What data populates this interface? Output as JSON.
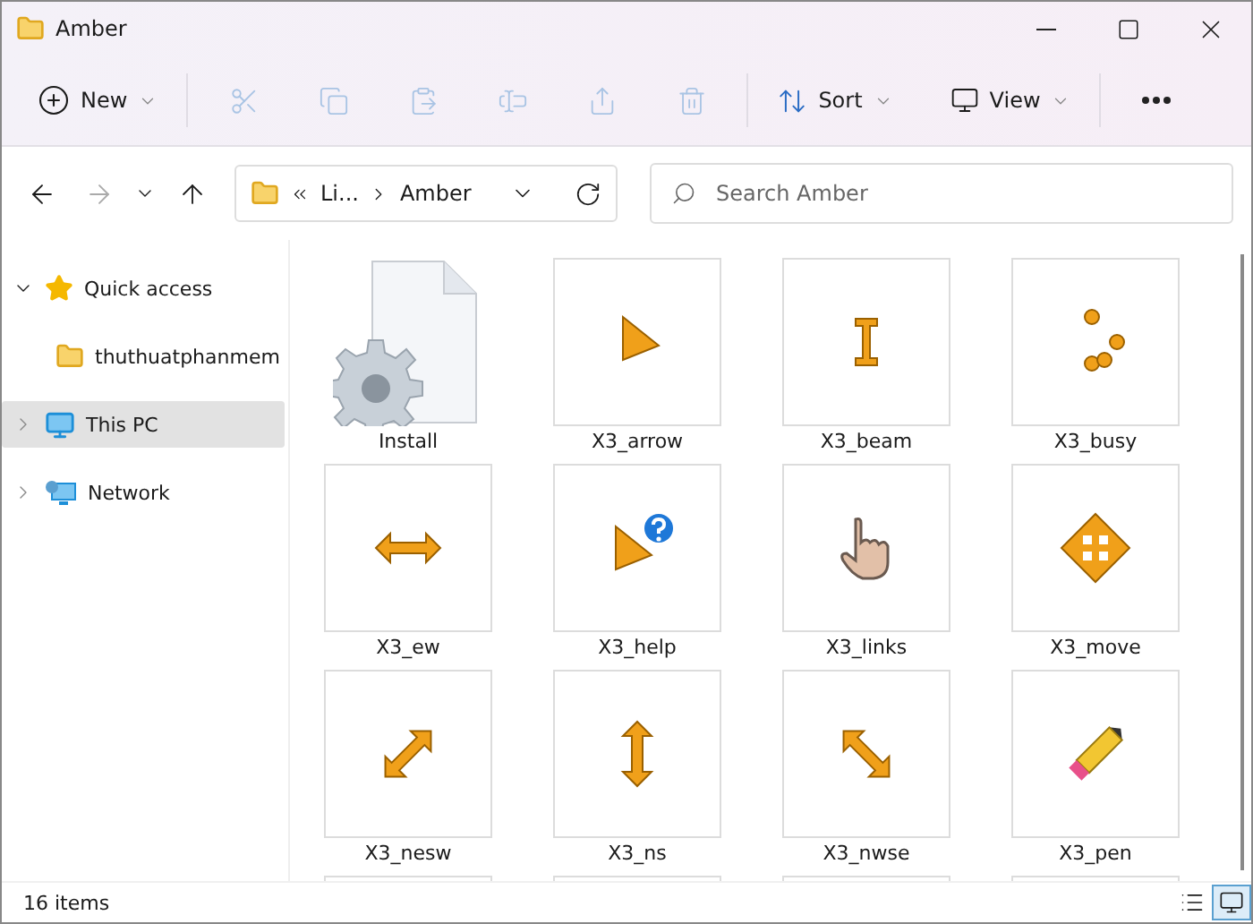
{
  "window": {
    "title": "Amber"
  },
  "toolbar": {
    "new": {
      "label": "New"
    },
    "actions": [
      {
        "disabled": true
      },
      {
        "disabled": true
      },
      {
        "disabled": true
      },
      {
        "disabled": true
      },
      {
        "disabled": true
      },
      {
        "disabled": true
      }
    ],
    "sort": {
      "label": "Sort"
    },
    "view": {
      "label": "View"
    }
  },
  "navigation": {
    "forward_disabled": true
  },
  "address": {
    "crumbs": [
      "Li...",
      "Amber"
    ]
  },
  "search": {
    "placeholder": "Search Amber"
  },
  "sidebar": {
    "items": [
      {
        "label": "Quick access",
        "expanded": true,
        "selected": false,
        "children": [
          {
            "label": "thuthuatphanmem",
            "selected": false
          }
        ]
      },
      {
        "label": "This PC",
        "expanded": false,
        "selected": true
      },
      {
        "label": "Network",
        "expanded": false,
        "selected": false
      }
    ]
  },
  "files": [
    {
      "kind": "file",
      "name": "Install"
    },
    {
      "kind": "thumbnail",
      "name": "X3_arrow"
    },
    {
      "kind": "thumbnail",
      "name": "X3_beam"
    },
    {
      "kind": "thumbnail",
      "name": "X3_busy"
    },
    {
      "kind": "thumbnail",
      "name": "X3_ew"
    },
    {
      "kind": "thumbnail",
      "name": "X3_help"
    },
    {
      "kind": "thumbnail",
      "name": "X3_links"
    },
    {
      "kind": "thumbnail",
      "name": "X3_move"
    },
    {
      "kind": "thumbnail",
      "name": "X3_nesw"
    },
    {
      "kind": "thumbnail",
      "name": "X3_ns"
    },
    {
      "kind": "thumbnail",
      "name": "X3_nwse"
    },
    {
      "kind": "thumbnail",
      "name": "X3_pen"
    },
    {
      "kind": "thumbnail"
    },
    {
      "kind": "thumbnail"
    },
    {
      "kind": "thumbnail"
    },
    {
      "kind": "thumbnail"
    }
  ],
  "status_bar": {
    "count": "16 items",
    "view_modes": [
      {
        "selected": false
      },
      {
        "selected": true
      }
    ]
  }
}
